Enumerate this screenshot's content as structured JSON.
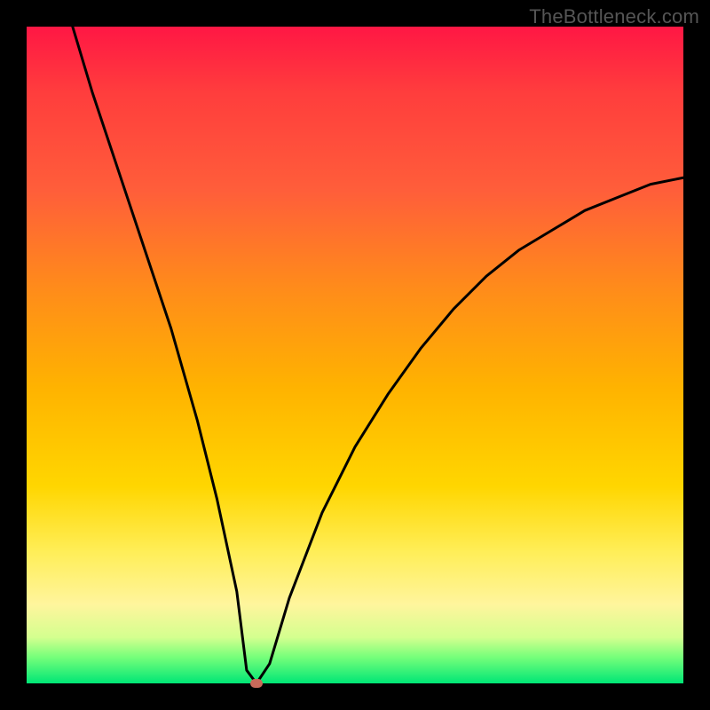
{
  "watermark": "TheBottleneck.com",
  "chart_data": {
    "type": "line",
    "title": "",
    "xlabel": "",
    "ylabel": "",
    "xlim": [
      0,
      100
    ],
    "ylim": [
      0,
      100
    ],
    "grid": false,
    "series": [
      {
        "name": "curve",
        "x": [
          7,
          10,
          14,
          18,
          22,
          26,
          29,
          32,
          33.5,
          35,
          37,
          40,
          45,
          50,
          55,
          60,
          65,
          70,
          75,
          80,
          85,
          90,
          95,
          100
        ],
        "y": [
          100,
          90,
          78,
          66,
          54,
          40,
          28,
          14,
          2,
          0,
          3,
          13,
          26,
          36,
          44,
          51,
          57,
          62,
          66,
          69,
          72,
          74,
          76,
          77
        ]
      }
    ],
    "marker": {
      "x": 35,
      "y": 0
    },
    "gradient_colors": {
      "top": "#ff1744",
      "mid": "#ffd600",
      "bottom": "#00e676"
    }
  }
}
